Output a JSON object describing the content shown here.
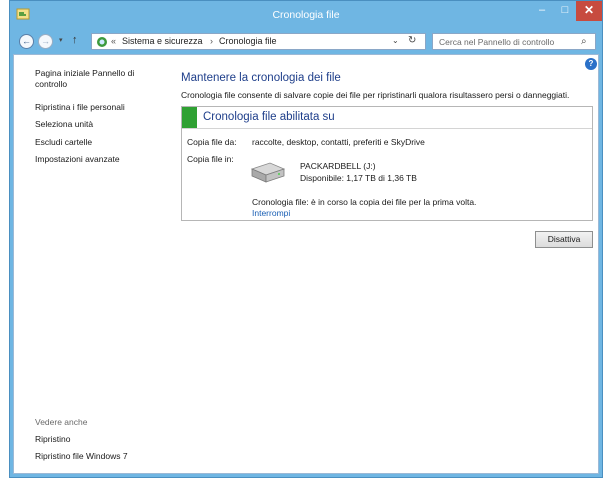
{
  "window": {
    "title": "Cronologia file",
    "minimize_glyph": "–",
    "maximize_glyph": "□",
    "close_glyph": "✕"
  },
  "nav": {
    "back_glyph": "←",
    "forward_glyph": "→",
    "dropdown_glyph": "▾",
    "up_glyph": "↑"
  },
  "address": {
    "chevron": "«",
    "crumbs": [
      "Sistema e sicurezza",
      "Cronologia file"
    ],
    "separator": "›",
    "dropdown_glyph": "⌄",
    "refresh_glyph": "↻"
  },
  "search": {
    "placeholder": "Cerca nel Pannello di controllo",
    "icon_glyph": "⌕"
  },
  "sidebar": {
    "home_link": "Pagina iniziale Pannello di controllo",
    "items": [
      "Ripristina i file personali",
      "Seleziona unità",
      "Escludi cartelle",
      "Impostazioni avanzate"
    ],
    "see_also_header": "Vedere anche",
    "see_also": [
      "Ripristino",
      "Ripristino file Windows 7"
    ]
  },
  "main": {
    "help_glyph": "?",
    "title": "Mantenere la cronologia dei file",
    "description": "Cronologia file consente di salvare copie dei file per ripristinarli qualora risultassero persi o danneggiati.",
    "status": "Cronologia file abilitata su",
    "copy_from_label": "Copia file da:",
    "copy_from_value": "raccolte, desktop, contatti, preferiti e SkyDrive",
    "copy_to_label": "Copia file in:",
    "drive_name": "PACKARDBELL (J:)",
    "drive_space": "Disponibile: 1,17 TB di 1,36 TB",
    "progress": "Cronologia file: è in corso la copia dei file per la prima volta.",
    "stop_link": "Interrompi",
    "disable_button": "Disattiva"
  },
  "colors": {
    "window_frame": "#6fb6e3",
    "title_color": "#1e3e8a",
    "status_green": "#2fa133",
    "close_red": "#c74b3f",
    "link_blue": "#1a5fb4"
  }
}
